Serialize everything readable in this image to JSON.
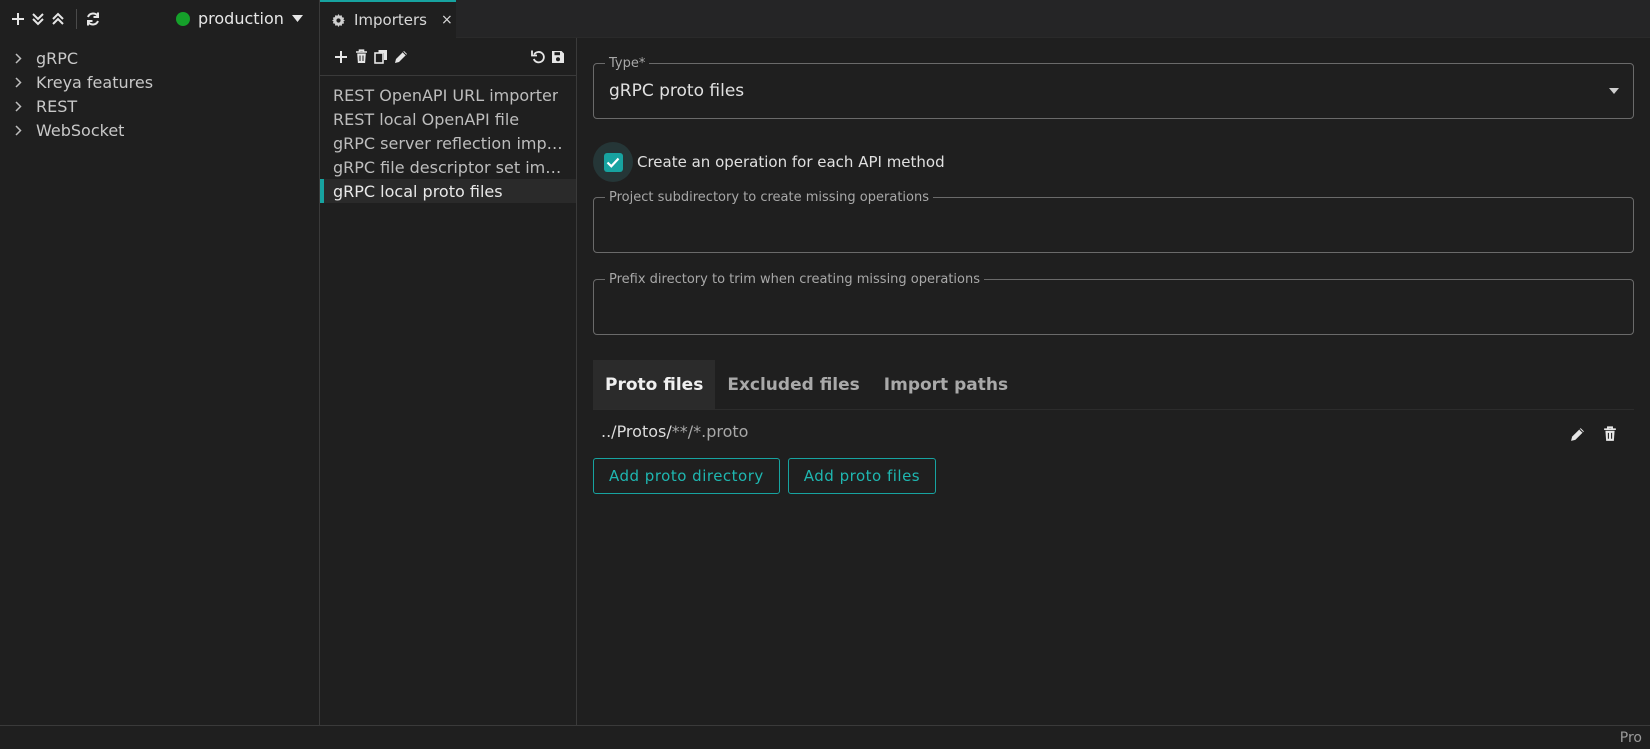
{
  "left_toolbar": {
    "icons": [
      "plus-icon",
      "expand-all-icon",
      "collapse-all-icon",
      "refresh-icon"
    ],
    "environment": {
      "name": "production",
      "status_color": "#15a02a"
    }
  },
  "tree": {
    "items": [
      {
        "label": "gRPC"
      },
      {
        "label": "Kreya features"
      },
      {
        "label": "REST"
      },
      {
        "label": "WebSocket"
      }
    ]
  },
  "tabs": [
    {
      "label": "Importers",
      "icon": "gear-icon",
      "close": "×"
    }
  ],
  "importer_list": {
    "toolbar_icons": [
      "plus-icon",
      "trash-icon",
      "copy-icon",
      "pencil-icon",
      "undo-icon",
      "save-icon"
    ],
    "items": [
      {
        "label": "REST OpenAPI URL importer",
        "active": false
      },
      {
        "label": "REST local OpenAPI file",
        "active": false
      },
      {
        "label": "gRPC server reflection imp…",
        "active": false
      },
      {
        "label": "gRPC file descriptor set im…",
        "active": false
      },
      {
        "label": "gRPC local proto files",
        "active": true
      }
    ]
  },
  "detail": {
    "type_field": {
      "label": "Type*",
      "value": "gRPC proto files"
    },
    "create_operations": {
      "label": "Create an operation for each API method",
      "checked": true
    },
    "subdirectory_field": {
      "label": "Project subdirectory to create missing operations",
      "value": ""
    },
    "prefix_field": {
      "label": "Prefix directory to trim when creating missing operations",
      "value": ""
    },
    "subtabs": [
      {
        "label": "Proto files",
        "active": true
      },
      {
        "label": "Excluded files",
        "active": false
      },
      {
        "label": "Import paths",
        "active": false
      }
    ],
    "proto_files": [
      {
        "path_main": "../Protos/",
        "path_glob": "**/*.proto"
      }
    ],
    "buttons": {
      "add_directory": "Add proto directory",
      "add_files": "Add proto files"
    }
  },
  "status_bar": {
    "right_text": "Pro"
  },
  "colors": {
    "accent": "#17a3a0",
    "background": "#1f1f1f",
    "environment_ok": "#15a02a"
  }
}
